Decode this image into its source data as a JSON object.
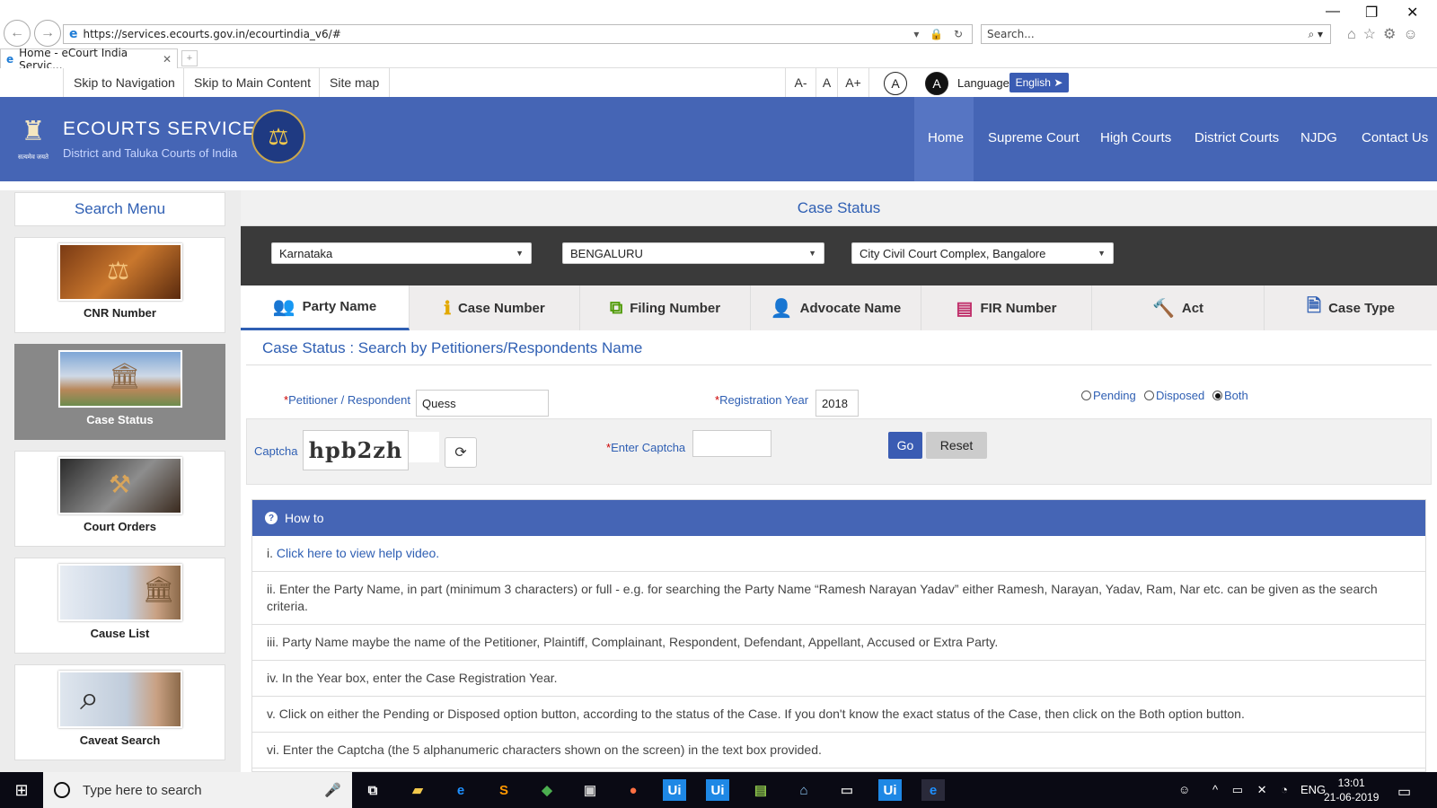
{
  "browser": {
    "url": "https://services.ecourts.gov.in/ecourtindia_v6/#",
    "search_placeholder": "Search...",
    "tab_title": "Home - eCourt India Servic..."
  },
  "access_bar": {
    "skip_nav": "Skip to Navigation",
    "skip_main": "Skip to Main Content",
    "site_map": "Site map",
    "font_small": "A-",
    "font_normal": "A",
    "font_large": "A+",
    "contrast_light": "A",
    "contrast_dark": "A",
    "language_label": "Language",
    "language_value": "English"
  },
  "header": {
    "emblem_caption": "सत्यमेव जयते",
    "title": "ECOURTS SERVICES",
    "subtitle": "District and Taluka Courts of India",
    "menu": [
      "Home",
      "Supreme Court",
      "High Courts",
      "District Courts",
      "NJDG",
      "Contact Us"
    ]
  },
  "sidebar": {
    "title": "Search Menu",
    "items": [
      {
        "label": "CNR Number",
        "icon": "scales-icon"
      },
      {
        "label": "Case Status",
        "icon": "court-building-icon"
      },
      {
        "label": "Court Orders",
        "icon": "gavel-icon"
      },
      {
        "label": "Cause List",
        "icon": "document-list-icon"
      },
      {
        "label": "Caveat Search",
        "icon": "magnifier-icon"
      }
    ]
  },
  "main": {
    "title": "Case Status",
    "selects": {
      "state": "Karnataka",
      "district": "BENGALURU",
      "court_complex": "City Civil Court Complex, Bangalore"
    },
    "tabs": [
      "Party Name",
      "Case Number",
      "Filing Number",
      "Advocate Name",
      "FIR Number",
      "Act",
      "Case Type"
    ],
    "section_heading": "Case Status : Search by Petitioners/Respondents Name",
    "form": {
      "required_mark": "*",
      "petitioner_label": "Petitioner / Respondent",
      "petitioner_value": "Quess",
      "year_label": "Registration Year",
      "year_value": "2018",
      "radio_pending": "Pending",
      "radio_disposed": "Disposed",
      "radio_both": "Both",
      "captcha_label": "Captcha",
      "captcha_text": "hpb2zh",
      "enter_captcha_label": "Enter Captcha",
      "go": "Go",
      "reset": "Reset"
    },
    "howto": {
      "title": "How to",
      "line1_prefix": "i. ",
      "line1_link": "Click here to view help video.",
      "line2": "ii. Enter the Party Name, in part (minimum 3 characters) or full - e.g. for searching the Party Name “Ramesh Narayan Yadav” either Ramesh, Narayan, Yadav, Ram, Nar etc. can be given as the search criteria.",
      "line3": "iii. Party Name maybe the name of the Petitioner, Plaintiff, Complainant, Respondent, Defendant, Appellant, Accused or Extra Party.",
      "line4": "iv. In the Year box, enter the Case Registration Year.",
      "line5": "v. Click on either the Pending or Disposed option button, according to the status of the Case. If you don't know the exact status of the Case, then click on the Both option button.",
      "line6": "vi. Enter the Captcha (the 5 alphanumeric characters shown on the screen) in the text box provided."
    }
  },
  "taskbar": {
    "search_placeholder": "Type here to search",
    "lang": "ENG",
    "time": "13:01",
    "date": "21-06-2019"
  }
}
